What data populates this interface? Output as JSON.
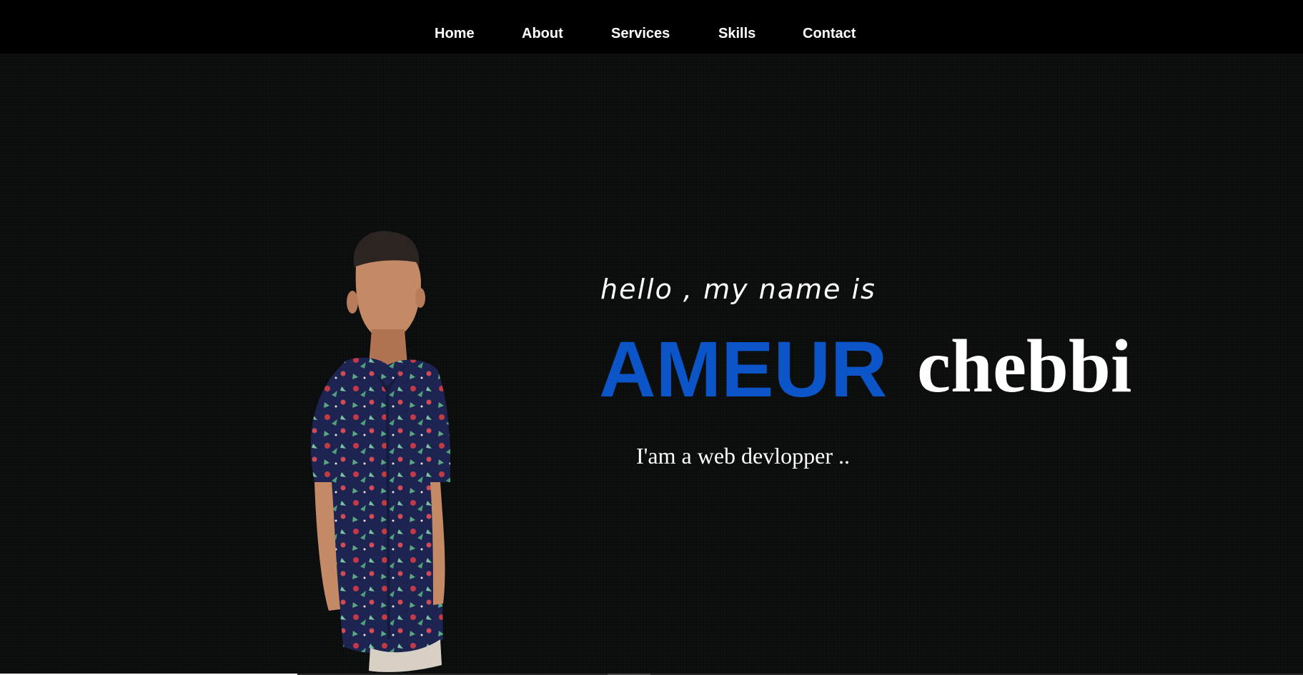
{
  "nav": {
    "items": [
      {
        "label": "Home"
      },
      {
        "label": "About"
      },
      {
        "label": "Services"
      },
      {
        "label": "Skills"
      },
      {
        "label": "Contact"
      }
    ]
  },
  "hero": {
    "greeting": "hello , my name is",
    "first_name": "AMEUR",
    "last_name": "chebbi",
    "tagline": "I'am a web devlopper .."
  },
  "colors": {
    "nav_background": "#000000",
    "hero_background": "#0b0c0c",
    "accent": "#0b55c9",
    "text": "#ffffff"
  },
  "icons": {
    "portrait": "person-portrait-image"
  }
}
